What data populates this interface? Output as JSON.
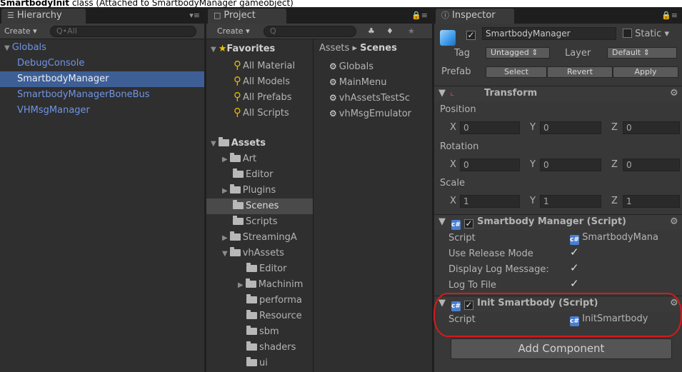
{
  "caption": {
    "bold": "SmartbodyInit",
    "rest": " class (Attached to SmartbodyManager gameobject)"
  },
  "hierarchy": {
    "tab": "Hierarchy",
    "create": "Create",
    "search_placeholder": "Q•All",
    "root": "Globals",
    "items": [
      "DebugConsole",
      "SmartbodyManager",
      "SmartbodyManagerBoneBus",
      "VHMsgManager"
    ]
  },
  "project": {
    "tab": "Project",
    "create": "Create",
    "search_placeholder": "Q",
    "favorites": "Favorites",
    "favorite_items": [
      "All Material",
      "All Models",
      "All Prefabs",
      "All Scripts"
    ],
    "assets": "Assets",
    "asset_items": [
      "Art",
      "Editor",
      "Plugins",
      "Scenes",
      "Scripts",
      "StreamingA",
      "vhAssets"
    ],
    "vh_items": [
      "Editor",
      "Machinim",
      "performa",
      "Resource",
      "sbm",
      "shaders",
      "ui"
    ],
    "breadcrumb_root": "Assets",
    "breadcrumb_sep": "▸",
    "breadcrumb_current": "Scenes",
    "scene_items": [
      "Globals",
      "MainMenu",
      "vhAssetsTestSc",
      "vhMsgEmulator"
    ]
  },
  "inspector": {
    "tab": "Inspector",
    "object_name": "SmartbodyManager",
    "static_label": "Static",
    "tag_label": "Tag",
    "tag_value": "Untagged",
    "layer_label": "Layer",
    "layer_value": "Default",
    "prefab_label": "Prefab",
    "prefab_select": "Select",
    "prefab_revert": "Revert",
    "prefab_apply": "Apply",
    "transform_title": "Transform",
    "position_label": "Position",
    "rotation_label": "Rotation",
    "scale_label": "Scale",
    "axis_x": "X",
    "axis_y": "Y",
    "axis_z": "Z",
    "position": [
      "0",
      "0",
      "0"
    ],
    "rotation": [
      "0",
      "0",
      "0"
    ],
    "scale": [
      "1",
      "1",
      "1"
    ],
    "sm_title": "Smartbody Manager (Script)",
    "sm_script_label": "Script",
    "sm_script_value": "SmartbodyMana",
    "sm_props": [
      "Use Release Mode",
      "Display Log Message:",
      "Log To File"
    ],
    "init_title": "Init Smartbody (Script)",
    "init_script_label": "Script",
    "init_script_value": "InitSmartbody",
    "add_component": "Add Component",
    "script_icon_glyph": "c#"
  },
  "colors": {
    "selection": "#3e5f96",
    "hierarchy_text": "#6f94e6",
    "annotation": "#d61a1a"
  }
}
